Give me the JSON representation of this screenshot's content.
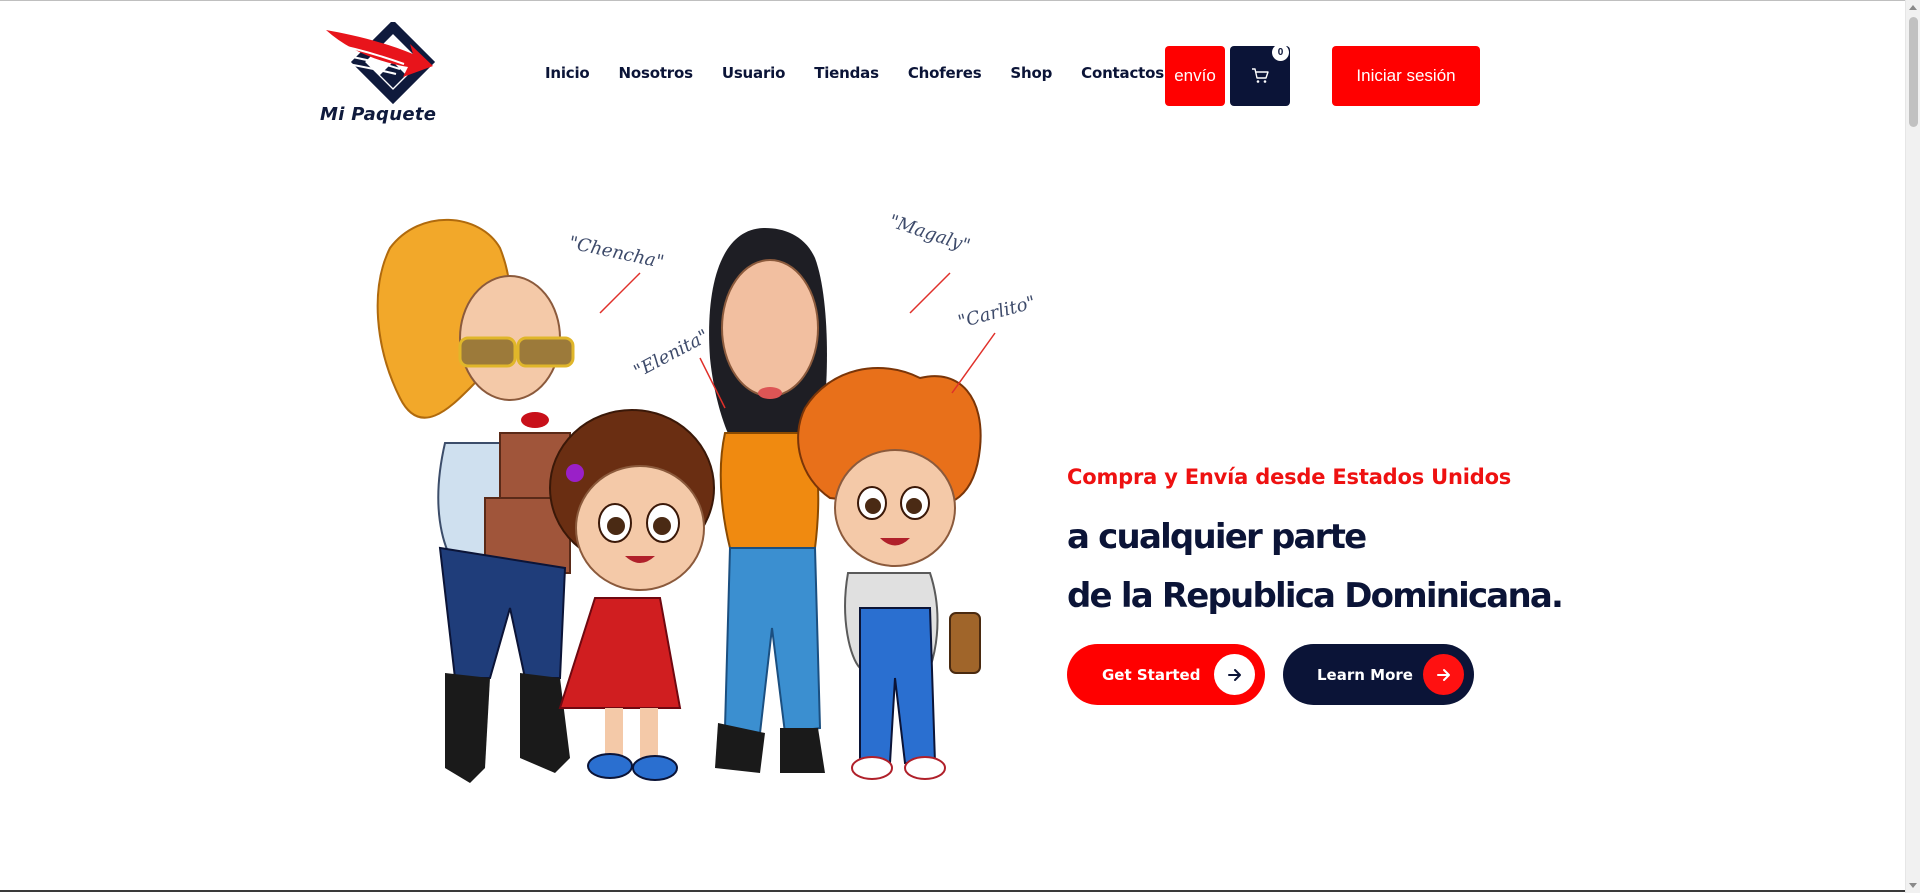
{
  "brand": {
    "name": "Mi Paquete",
    "primary_red": "#ff0000",
    "navy": "#0b1437"
  },
  "nav": {
    "items": [
      {
        "label": "Inicio"
      },
      {
        "label": "Nosotros"
      },
      {
        "label": "Usuario"
      },
      {
        "label": "Tiendas"
      },
      {
        "label": "Choferes"
      },
      {
        "label": "Shop"
      },
      {
        "label": "Contactos"
      }
    ]
  },
  "header": {
    "envio_label": "envío",
    "cart_icon": "cart-icon",
    "cart_count": "0",
    "login_label": "Iniciar sesión"
  },
  "hero": {
    "subtitle": "Compra y Envía desde Estados Unidos",
    "title_line1": "a cualquier parte",
    "title_line2": "de la Republica Dominicana.",
    "illustration_names": [
      "\"Chencha\"",
      "\"Magaly\"",
      "\"Carlito\"",
      "\"Elenita\""
    ],
    "buttons": {
      "get_started": "Get Started",
      "learn_more": "Learn More",
      "arrow_icon": "arrow-right-icon"
    }
  }
}
